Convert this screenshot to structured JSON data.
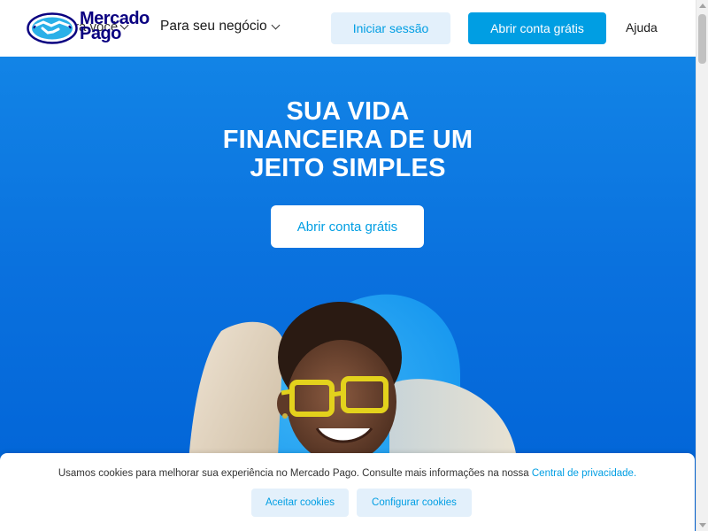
{
  "header": {
    "logo": {
      "line1": "Mercado",
      "line2": "Pago"
    },
    "nav_personal_label": "ra você",
    "nav_business_label": "Para seu negócio",
    "login_label": "Iniciar sessão",
    "open_account_label": "Abrir conta grátis",
    "help_label": "Ajuda"
  },
  "hero": {
    "title_lines": [
      "SUA VIDA",
      "FINANCEIRA DE UM",
      "JEITO SIMPLES"
    ],
    "cta_label": "Abrir conta grátis"
  },
  "cookie_banner": {
    "text": "Usamos cookies para melhorar sua experiência no Mercado Pago. Consulte mais informações na nossa",
    "link_label": "Central de privacidade.",
    "accept_label": "Aceitar cookies",
    "configure_label": "Configurar cookies"
  },
  "colors": {
    "brand_blue": "#009ee3",
    "hero_blue": "#0a71de",
    "logo_navy": "#0a0080",
    "light_button": "#e3f0fb"
  },
  "icons": {
    "logo": "handshake-logo-icon",
    "dropdown": "chevron-down-icon"
  }
}
